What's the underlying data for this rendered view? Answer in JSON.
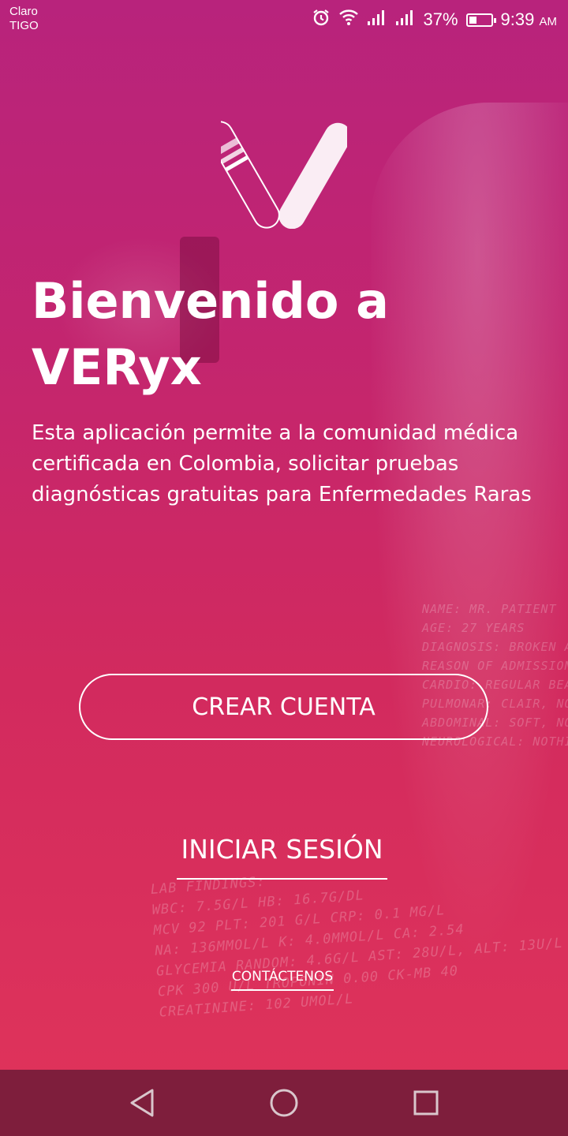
{
  "status_bar": {
    "carrier_1": "Claro",
    "carrier_2": "TIGO",
    "battery_percent": "37%",
    "battery_level": 0.37,
    "time": "9:39",
    "time_suffix": "AM",
    "icons": [
      "alarm-icon",
      "wifi-icon",
      "signal-icon",
      "signal-icon",
      "battery-icon"
    ]
  },
  "welcome": {
    "title_line_1": "Bienvenido a",
    "title_line_2": "VERyx",
    "description": "Esta aplicación permite a la comunidad médica certificada en Colombia, solicitar pruebas diagnósticas gratuitas para Enfermedades Raras"
  },
  "actions": {
    "create_account": "CREAR CUENTA",
    "login": "INICIAR SESIÓN",
    "contact": "CONTÁCTENOS"
  },
  "background_text": {
    "patient_card": [
      "NAME: MR. PATIENT",
      "AGE: 27 YEARS",
      "DIAGNOSIS: BROKEN A",
      "REASON OF ADMISSION",
      "CARDIO: REGULAR BEA",
      "PULMONAR: CLAIR, NO",
      "ABDOMINAL: SOFT, NO D",
      "NEUROLOGICAL: NOTHING"
    ],
    "lab_findings": [
      "LAB FINDINGS:",
      "WBC: 7.5G/L HB: 16.7G/DL",
      "MCV 92 PLT: 201 G/L CRP: 0.1 MG/L",
      "NA: 136MMOL/L K: 4.0MMOL/L CA: 2.54",
      "GLYCEMIA RANDOM: 4.6G/L AST: 28U/L, ALT: 13U/L",
      "CPK 300 U/L TROPONIN 0.00 CK-MB 40",
      "CREATININE: 102 UMOL/L"
    ]
  },
  "navigation": {
    "icons": [
      "back-icon",
      "home-icon",
      "recents-icon"
    ]
  },
  "colors": {
    "gradient_top": "#b8237c",
    "gradient_bottom": "#e0345a",
    "nav_bar": "#7e1e3c",
    "text": "#ffffff"
  }
}
